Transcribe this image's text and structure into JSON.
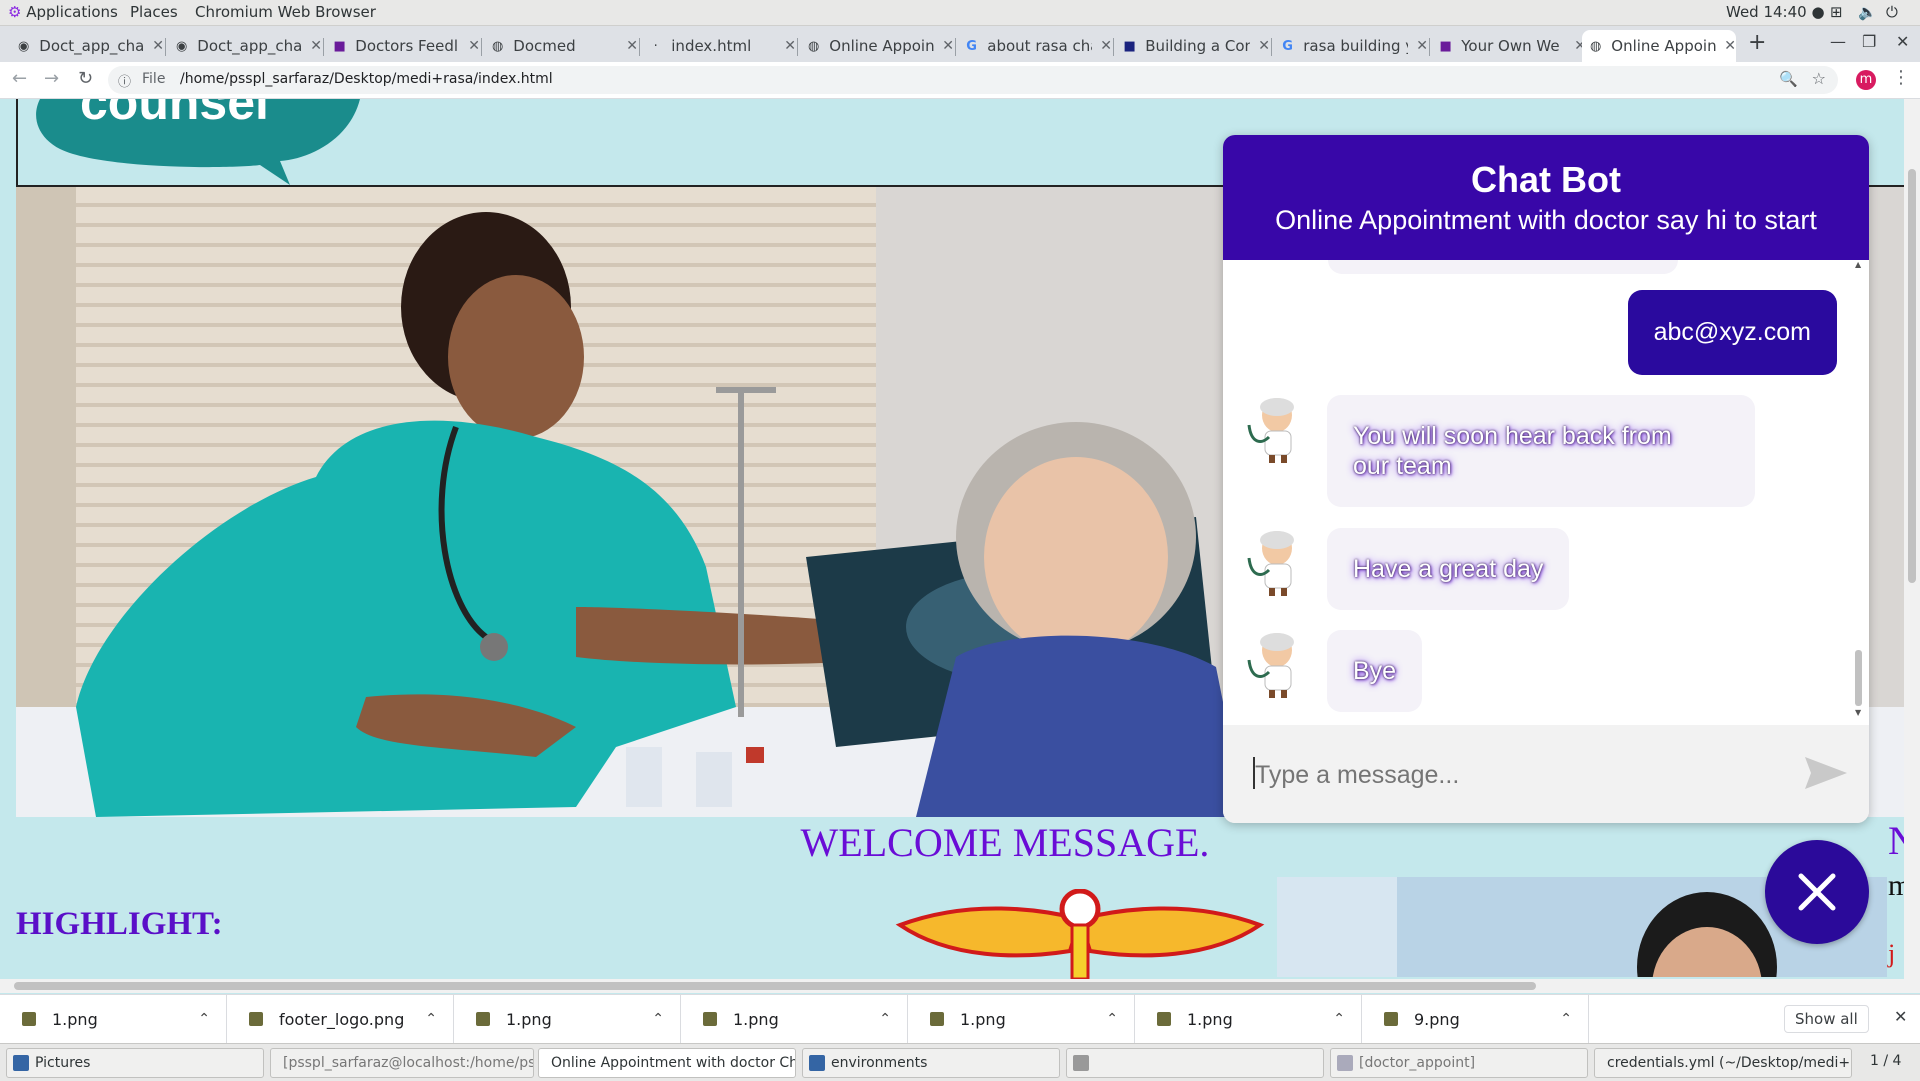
{
  "gnome": {
    "applications": "Applications",
    "places": "Places",
    "app_name": "Chromium Web Browser",
    "clock": "Wed 14:40"
  },
  "tabs": [
    {
      "title": "Doct_app_cha",
      "icon": "github-icon"
    },
    {
      "title": "Doct_app_cha",
      "icon": "github-icon"
    },
    {
      "title": "Doctors Feedl",
      "icon": "page-icon"
    },
    {
      "title": "Docmed",
      "icon": "globe-icon"
    },
    {
      "title": "index.html",
      "icon": "file-icon"
    },
    {
      "title": "Online Appoin",
      "icon": "globe-icon"
    },
    {
      "title": "about rasa cha",
      "icon": "google-icon"
    },
    {
      "title": "Building a Con",
      "icon": "page-icon"
    },
    {
      "title": "rasa building y",
      "icon": "google-icon"
    },
    {
      "title": "Your Own We",
      "icon": "page-icon"
    },
    {
      "title": "Online Appoin",
      "icon": "globe-icon",
      "active": true
    }
  ],
  "toolbar": {
    "scheme_label": "File",
    "url": "/home/psspl_sarfaraz/Desktop/medi+rasa/index.html",
    "profile_initial": "m"
  },
  "page": {
    "logo_text": "counsel",
    "welcome": "WELCOME MESSAGE.",
    "highlight": "HIGHLIGHT:",
    "right_edge_letter": "N",
    "right_edge_m": "m",
    "right_edge_j": "j"
  },
  "chat": {
    "title": "Chat Bot",
    "subtitle": "Online Appointment with doctor say hi to start",
    "messages": [
      {
        "from": "user",
        "text": "abc@xyz.com"
      },
      {
        "from": "bot",
        "text_line1": "You will soon hear back from",
        "text_line2": "our team"
      },
      {
        "from": "bot",
        "text": "Have a great day"
      },
      {
        "from": "bot",
        "text": "Bye"
      }
    ],
    "input_placeholder": "Type a message...",
    "accent_color": "#3807a8"
  },
  "downloads": {
    "items": [
      "1.png",
      "footer_logo.png",
      "1.png",
      "1.png",
      "1.png",
      "1.png",
      "9.png"
    ],
    "show_all": "Show all"
  },
  "taskbar": {
    "items": [
      "Pictures",
      "[psspl_sarfaraz@localhost:/home/ps...",
      "Online Appointment with doctor Ch...",
      "environments",
      "",
      "[doctor_appoint]",
      "credentials.yml (~/Desktop/medi+ra..."
    ],
    "workspace": "1 / 4"
  }
}
